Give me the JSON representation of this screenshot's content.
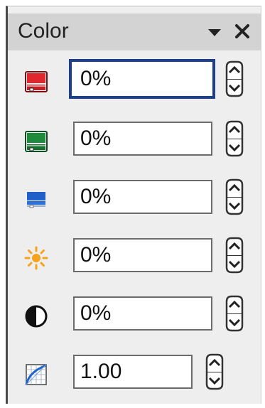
{
  "panel": {
    "title": "Color",
    "dropdown_icon": "chevron-down-icon",
    "close_icon": "close-icon"
  },
  "rows": [
    {
      "name": "red",
      "icon": "red-channel-icon",
      "value": "0%",
      "focused": true,
      "accent": "#e1272b"
    },
    {
      "name": "green",
      "icon": "green-channel-icon",
      "value": "0%",
      "focused": false,
      "accent": "#1e8a3c"
    },
    {
      "name": "blue",
      "icon": "blue-channel-icon",
      "value": "0%",
      "focused": false,
      "accent": "#2060c8"
    },
    {
      "name": "brightness",
      "icon": "sun-icon",
      "value": "0%",
      "focused": false,
      "accent": "#f7a21b"
    },
    {
      "name": "contrast",
      "icon": "contrast-icon",
      "value": "0%",
      "focused": false,
      "accent": "#111111"
    },
    {
      "name": "gamma",
      "icon": "gamma-curve-icon",
      "value": "1.00",
      "focused": false,
      "accent": "#1f66c9"
    }
  ]
}
